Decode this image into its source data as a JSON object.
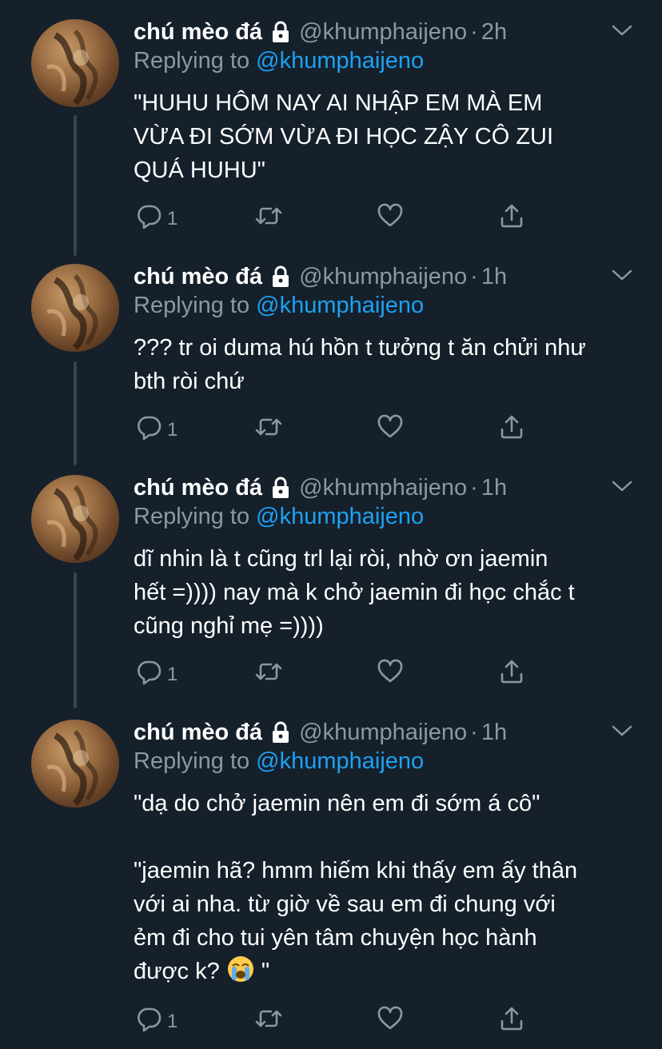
{
  "tweets": [
    {
      "name": "chú mèo đá",
      "handle": "@khumphaijeno",
      "separator": "·",
      "time": "2h",
      "replying_prefix": "Replying to",
      "replying_to": "@khumphaijeno",
      "text": "\"HUHU HÔM NAY AI NHẬP EM MÀ EM\nVỪA ĐI SỚM VỪA ĐI HỌC ZẬY CÔ ZUI\nQUÁ HUHU\"",
      "reply_count": "1"
    },
    {
      "name": "chú mèo đá",
      "handle": "@khumphaijeno",
      "separator": "·",
      "time": "1h",
      "replying_prefix": "Replying to",
      "replying_to": "@khumphaijeno",
      "text": "??? tr oi duma hú hồn t tưởng t ăn chửi như\nbth ròi chứ",
      "reply_count": "1"
    },
    {
      "name": "chú mèo đá",
      "handle": "@khumphaijeno",
      "separator": "·",
      "time": "1h",
      "replying_prefix": "Replying to",
      "replying_to": "@khumphaijeno",
      "text": "dĩ nhin là t cũng trl lại ròi, nhờ ơn jaemin\nhết =)))) nay mà k chở jaemin đi học chắc t\ncũng nghỉ mẹ =))))",
      "reply_count": "1"
    },
    {
      "name": "chú mèo đá",
      "handle": "@khumphaijeno",
      "separator": "·",
      "time": "1h",
      "replying_prefix": "Replying to",
      "replying_to": "@khumphaijeno",
      "text": "\"dạ do chở jaemin nên em đi sớm á cô\"\n\n\"jaemin hã? hmm hiếm khi thấy em ấy thân\nvới ai nha. từ giờ về sau em đi chung với\nẻm đi cho tui yên tâm chuyện học hành\nđược k? ",
      "text_suffix": "\"",
      "emoji": "loudly-crying-face",
      "reply_count": "1"
    }
  ],
  "colors": {
    "background": "#15202b",
    "secondary_text": "#8899a6",
    "link": "#1da1f2",
    "thread_line": "#38444d"
  },
  "icons": [
    "lock-icon",
    "chevron-down-icon",
    "reply-icon",
    "retweet-icon",
    "like-icon",
    "share-icon",
    "avatar"
  ]
}
